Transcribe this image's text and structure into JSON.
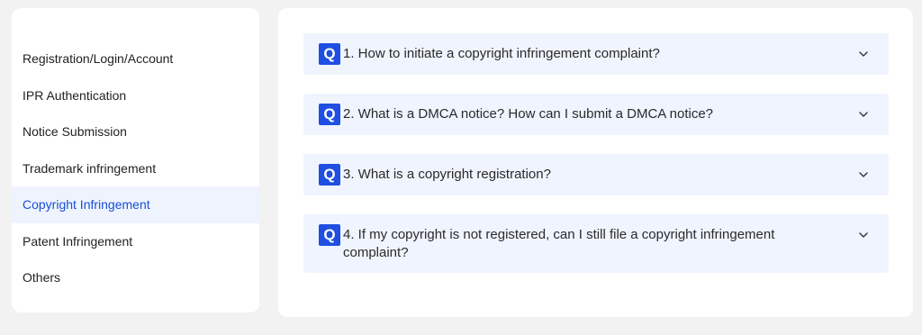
{
  "sidebar": {
    "items": [
      {
        "label": "Registration/Login/Account"
      },
      {
        "label": "IPR Authentication"
      },
      {
        "label": "Notice Submission"
      },
      {
        "label": "Trademark infringement"
      },
      {
        "label": "Copyright Infringement",
        "active": true
      },
      {
        "label": "Patent Infringement"
      },
      {
        "label": "Others"
      }
    ]
  },
  "faq": {
    "badge": "Q",
    "items": [
      {
        "question": "1. How to initiate a copyright infringement complaint?"
      },
      {
        "question": "2. What is a DMCA notice? How can I submit a DMCA notice?"
      },
      {
        "question": "3. What is a copyright registration?"
      },
      {
        "question": "4. If my copyright is not registered, can I still file a copyright infringement complaint?"
      }
    ]
  },
  "colors": {
    "accent": "#1f4fe0",
    "active_sidebar_text": "#1a4fd6",
    "active_sidebar_bg": "#eef3fe",
    "faq_bg": "#eff4fe",
    "page_bg": "#f2f2f2"
  },
  "icons": {
    "expand": "chevron-down-icon"
  }
}
